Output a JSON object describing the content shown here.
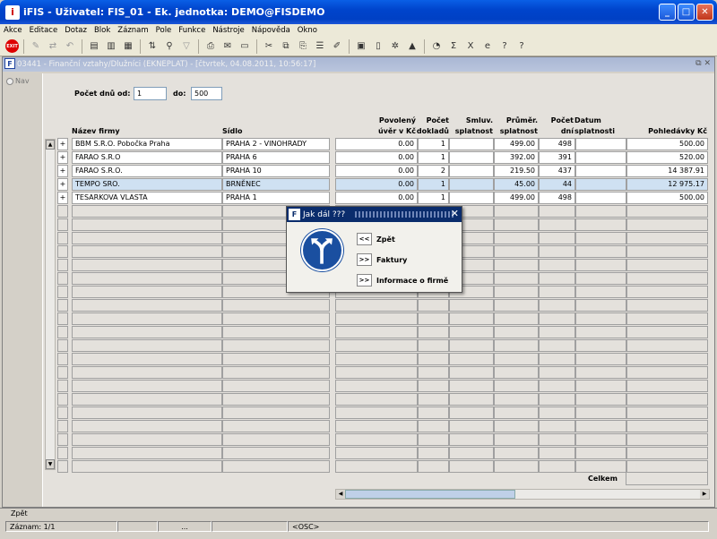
{
  "window": {
    "title": "iFIS - Uživatel: FIS_01 - Ek. jednotka: DEMO@FISDEMO"
  },
  "menu": [
    "Akce",
    "Editace",
    "Dotaz",
    "Blok",
    "Záznam",
    "Pole",
    "Funkce",
    "Nástroje",
    "Nápověda",
    "Okno"
  ],
  "toolbar": {
    "exit_label": "EXIT"
  },
  "form": {
    "title": "03441 - Finanční vztahy/Dlužníci (EKNEPLAT) - [čtvrtek, 04.08.2011, 10:56:17]",
    "nav_label": "Nav",
    "days_from_label": "Počet dnů od:",
    "days_from_value": "1",
    "days_to_label": "do:",
    "days_to_value": "500",
    "total_label": "Celkem"
  },
  "columns": {
    "name": "Název firmy",
    "seat": "Sídlo",
    "credit_line1": "Povolený",
    "credit_line2": "úvěr v Kč",
    "docs_line1": "Počet",
    "docs_line2": "dokladů",
    "contract_line1": "Smluv.",
    "contract_line2": "splatnost",
    "avg_line1": "Průměr.",
    "avg_line2": "splatnost",
    "days_line1": "Počet",
    "days_line2": "dní",
    "due_line1": "Datum",
    "due_line2": "splatnosti",
    "receivables": "Pohledávky Kč"
  },
  "rows": [
    {
      "marker": "+",
      "name": "BBM S.R.O. Pobočka Praha",
      "seat": "PRAHA 2 - VINOHRADY",
      "credit": "0.00",
      "docs": "1",
      "contract": "",
      "avg": "499.00",
      "days": "498",
      "due": "",
      "receivables": "500.00"
    },
    {
      "marker": "+",
      "name": "FARAO S.R.O",
      "seat": "PRAHA 6",
      "credit": "0.00",
      "docs": "1",
      "contract": "",
      "avg": "392.00",
      "days": "391",
      "due": "",
      "receivables": "520.00"
    },
    {
      "marker": "+",
      "name": "FARAO S.R.O.",
      "seat": "PRAHA 10",
      "credit": "0.00",
      "docs": "2",
      "contract": "",
      "avg": "219.50",
      "days": "437",
      "due": "",
      "receivables": "14 387.91"
    },
    {
      "marker": "+",
      "name": "TEMPO SRO.",
      "seat": "BRNĚNEC",
      "credit": "0.00",
      "docs": "1",
      "contract": "",
      "avg": "45.00",
      "days": "44",
      "due": "",
      "receivables": "12 975.17"
    },
    {
      "marker": "+",
      "name": "TESARKOVA VLASTA",
      "seat": "PRAHA 1",
      "credit": "0.00",
      "docs": "1",
      "contract": "",
      "avg": "499.00",
      "days": "498",
      "due": "",
      "receivables": "500.00"
    }
  ],
  "selected_row": 3,
  "dialog": {
    "title": "Jak dál ???",
    "options": [
      {
        "button": "<<",
        "label": "Zpět"
      },
      {
        "button": ">>",
        "label": "Faktury"
      },
      {
        "button": ">>",
        "label": "Informace o firmě"
      }
    ]
  },
  "status": {
    "message": "Zpět",
    "record": "Záznam: 1/1",
    "ellipsis": "...",
    "osc": "<OSC>"
  }
}
